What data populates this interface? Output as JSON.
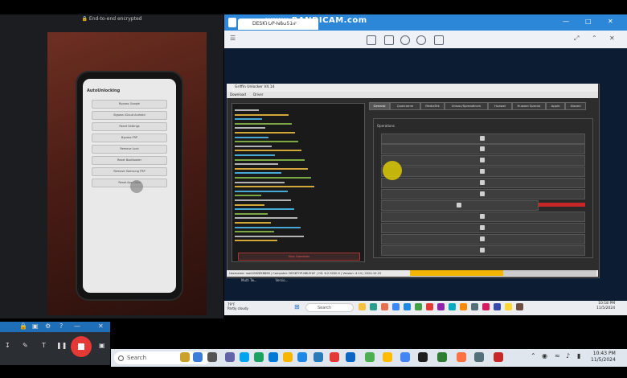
{
  "camera": {
    "e2e_label": "End-to-end encrypted",
    "phone_title": "AutoUnlocking",
    "phone_buttons": [
      "Bypass Google",
      "Bypass iCloud Android",
      "Reset Settings",
      "Bypass FRP",
      "Remove Lock",
      "Reset Bootloader",
      "Remove Samsung FRP",
      "Reset App Data"
    ]
  },
  "remote": {
    "tab_label": "DESKTOP-N8U51IF",
    "watermark": "www.BANDICAM.com"
  },
  "tool": {
    "title": "Griffin Unlocker V4.14",
    "menu": [
      "Download",
      "Driver"
    ],
    "tabs": [
      "General",
      "Qualcomm",
      "MediaTek",
      "Unisoc/Spreadtrum",
      "Huawei",
      "Huawei Special",
      "Apple",
      "Xiaomi"
    ],
    "active_tab": "General",
    "operations_label": "Operations",
    "log_button": "Stop Operation",
    "status": "Username: root1082658898  |  Computer: DESKTOP-N8U51IF  |  OS: 6.2.9200.0  |  Version: 4.14  |  2024-10-22",
    "extra": [
      "Multi Tw...",
      "Versio..."
    ],
    "progress": 0.5
  },
  "inner_taskbar": {
    "weather_temp": "79°F",
    "weather_desc": "Partly cloudy",
    "search": "Search",
    "time": "10:18 PM",
    "date": "11/5/2024"
  },
  "outer_taskbar": {
    "search": "Search",
    "time": "10:43 PM",
    "date": "11/5/2024"
  },
  "colors": {
    "rd_bar": "#2c87d8",
    "progress": "#f3b600",
    "record_stop": "#e53935"
  }
}
